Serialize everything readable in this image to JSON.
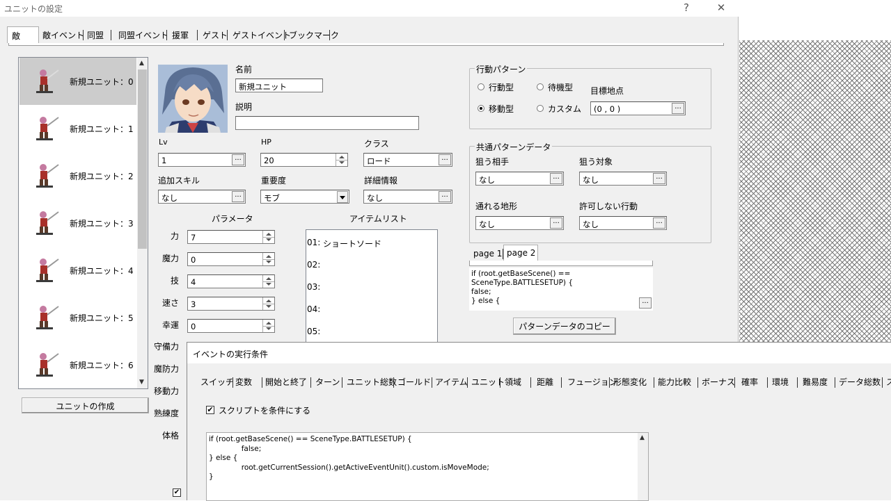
{
  "window": {
    "title": "ユニットの設定",
    "help_glyph": "?",
    "close_glyph": "✕"
  },
  "tabs": [
    {
      "label": "敵",
      "selected": true
    },
    {
      "label": "敵イベント"
    },
    {
      "label": "同盟"
    },
    {
      "label": "同盟イベント"
    },
    {
      "label": "援軍"
    },
    {
      "label": "ゲスト"
    },
    {
      "label": "ゲストイベント"
    },
    {
      "label": "ブックマーク"
    }
  ],
  "units": [
    {
      "label": "新規ユニット：0",
      "selected": true
    },
    {
      "label": "新規ユニット：1"
    },
    {
      "label": "新規ユニット：2"
    },
    {
      "label": "新規ユニット：3"
    },
    {
      "label": "新規ユニット：4"
    },
    {
      "label": "新規ユニット：5"
    },
    {
      "label": "新規ユニット：6"
    }
  ],
  "create_unit_button": "ユニットの作成",
  "name": {
    "label": "名前",
    "value": "新規ユニット"
  },
  "description": {
    "label": "説明",
    "value": ""
  },
  "lv": {
    "label": "Lv",
    "value": "1"
  },
  "hp": {
    "label": "HP",
    "value": "20"
  },
  "class": {
    "label": "クラス",
    "value": "ロード"
  },
  "extra_skill": {
    "label": "追加スキル",
    "value": "なし"
  },
  "importance": {
    "label": "重要度",
    "value": "モブ"
  },
  "details": {
    "label": "詳細情報",
    "value": "なし"
  },
  "params": {
    "header": "パラメータ",
    "rows": [
      {
        "label": "力",
        "value": "7"
      },
      {
        "label": "魔力",
        "value": "0"
      },
      {
        "label": "技",
        "value": "4"
      },
      {
        "label": "速さ",
        "value": "3"
      },
      {
        "label": "幸運",
        "value": "0"
      },
      {
        "label": "守備力"
      },
      {
        "label": "魔防力"
      },
      {
        "label": "移動力"
      },
      {
        "label": "熟練度"
      },
      {
        "label": "体格"
      }
    ]
  },
  "items": {
    "header": "アイテムリスト",
    "rows": [
      {
        "num": "01:",
        "name": "ショートソード"
      },
      {
        "num": "02:",
        "name": ""
      },
      {
        "num": "03:",
        "name": ""
      },
      {
        "num": "04:",
        "name": ""
      },
      {
        "num": "05:",
        "name": ""
      }
    ]
  },
  "action_pattern": {
    "title": "行動パターン",
    "options": [
      {
        "label": "行動型",
        "on": false
      },
      {
        "label": "待機型",
        "on": false
      },
      {
        "label": "移動型",
        "on": true
      },
      {
        "label": "カスタム",
        "on": false
      }
    ],
    "target_label": "目標地点",
    "target_value": "(0 , 0 )"
  },
  "common_pattern": {
    "title": "共通パターンデータ",
    "aim_target": {
      "label": "狙う相手",
      "value": "なし"
    },
    "aim_object": {
      "label": "狙う対象",
      "value": "なし"
    },
    "terrain": {
      "label": "通れる地形",
      "value": "なし"
    },
    "forbidden": {
      "label": "許可しない行動",
      "value": "なし"
    }
  },
  "page_tabs": [
    {
      "label": "page 1"
    },
    {
      "label": "page 2",
      "selected": true
    }
  ],
  "page_script": "if (root.getBaseScene() ==\nSceneType.BATTLESETUP) {\nfalse;\n} else {",
  "copy_pattern_button": "パターンデータのコピー",
  "ellipsis": "...",
  "event_dialog": {
    "title": "イベントの実行条件",
    "tabs": [
      "スイッチ",
      "変数",
      "開始と終了",
      "ターン",
      "ユニット総数",
      "ゴールド",
      "アイテム",
      "ユニット",
      "領域",
      "距離",
      "フュージョン",
      "形態変化",
      "能力比較",
      "ボーナス",
      "確率",
      "環境",
      "難易度",
      "データ総数",
      "ス"
    ],
    "script_checkbox": {
      "label": "スクリプトを条件にする",
      "checked": true
    },
    "script": "if (root.getBaseScene() == SceneType.BATTLESETUP) {\n              false;\n} else {\n              root.getCurrentSession().getActiveEventUnit().custom.isMoveMode;\n}"
  }
}
